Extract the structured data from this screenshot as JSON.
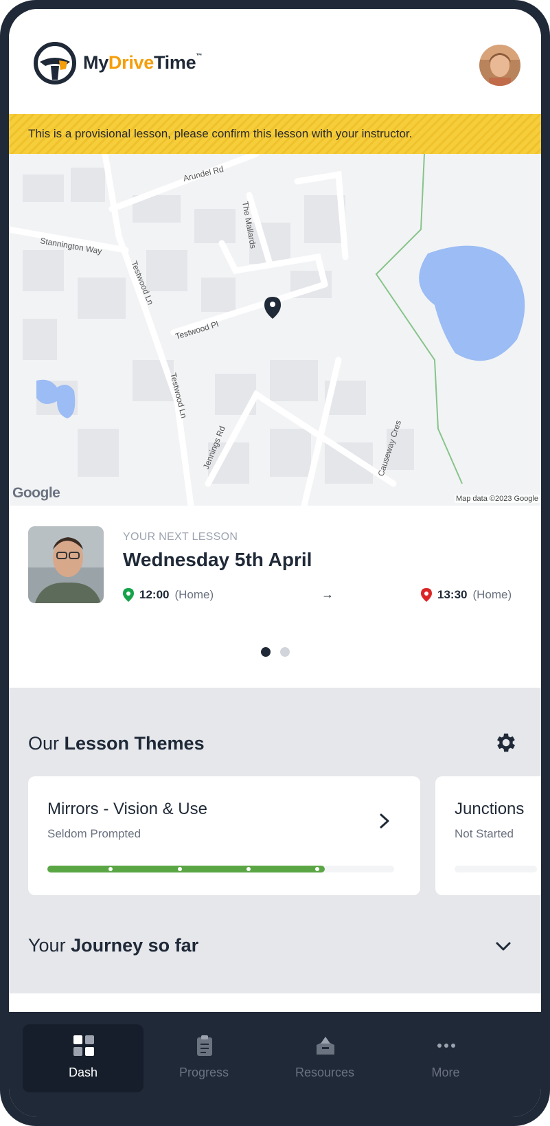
{
  "header": {
    "brand_prefix": "My",
    "brand_accent": "Drive",
    "brand_suffix": "Time",
    "brand_mark": "™",
    "accent_color": "#f59e0b"
  },
  "banner": {
    "text": "This is a provisional lesson, please confirm this lesson with your instructor."
  },
  "map": {
    "streets": [
      "Arundel Rd",
      "The Mallards",
      "Stannington Way",
      "Testwood Ln",
      "Testwood Pl",
      "Testwood Ln",
      "Jennings Rd",
      "Causeway Cres"
    ],
    "logo_text": "Google",
    "attribution": "Map data ©2023 Google"
  },
  "next_lesson": {
    "kicker": "YOUR NEXT LESSON",
    "date": "Wednesday 5th April",
    "start_time": "12:00",
    "start_place": "(Home)",
    "end_time": "13:30",
    "end_place": "(Home)",
    "arrow": "→",
    "page_count": 2,
    "active_page": 1
  },
  "themes": {
    "title_regular": "Our ",
    "title_bold": "Lesson Themes",
    "cards": [
      {
        "title": "Mirrors - Vision & Use",
        "status": "Seldom Prompted",
        "progress": 0.8
      },
      {
        "title": "Junctions",
        "status": "Not Started",
        "progress": 0
      }
    ]
  },
  "journey": {
    "title_regular": "Your ",
    "title_bold": "Journey so far"
  },
  "nav": {
    "items": [
      {
        "label": "Dash",
        "icon": "dashboard-icon",
        "active": true
      },
      {
        "label": "Progress",
        "icon": "clipboard-icon",
        "active": false
      },
      {
        "label": "Resources",
        "icon": "resources-icon",
        "active": false
      },
      {
        "label": "More",
        "icon": "more-icon",
        "active": false
      }
    ]
  }
}
